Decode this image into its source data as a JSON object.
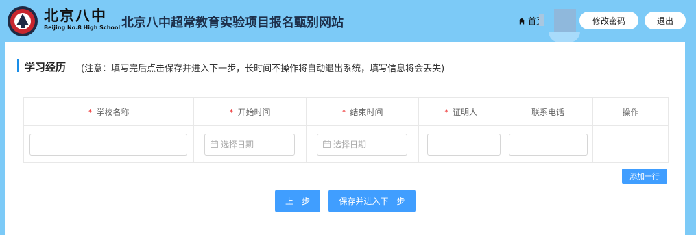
{
  "header": {
    "logo_text": "北京八中",
    "logo_subtitle": "Beijing No.8 High School",
    "site_title": "北京八中超常教育实验项目报名甄别网站",
    "home_label": "首页",
    "change_password_label": "修改密码",
    "logout_label": "退出"
  },
  "section": {
    "title": "学习经历",
    "note": "(注意：填写完后点击保存并进入下一步，长时间不操作将自动退出系统，填写信息将会丢失)"
  },
  "table": {
    "columns": [
      {
        "label": "学校名称",
        "required": "*"
      },
      {
        "label": "开始时间",
        "required": "*"
      },
      {
        "label": "结束时间",
        "required": "*"
      },
      {
        "label": "证明人",
        "required": "*"
      },
      {
        "label": "联系电话",
        "required": ""
      },
      {
        "label": "操作",
        "required": ""
      }
    ],
    "row": {
      "school_value": "",
      "start_placeholder": "选择日期",
      "end_placeholder": "选择日期",
      "witness_value": "",
      "phone_value": ""
    }
  },
  "actions": {
    "add_row_label": "添加一行",
    "prev_label": "上一步",
    "save_next_label": "保存并进入下一步"
  },
  "colors": {
    "page_background": "#7ccaf7",
    "primary_button": "#409eff",
    "section_accent": "#1a8ee8",
    "required_mark": "#e33333",
    "title_text": "#1d2f4a"
  },
  "icons": {
    "emblem": "school-emblem-icon",
    "home": "home-icon",
    "calendar": "calendar-icon"
  }
}
